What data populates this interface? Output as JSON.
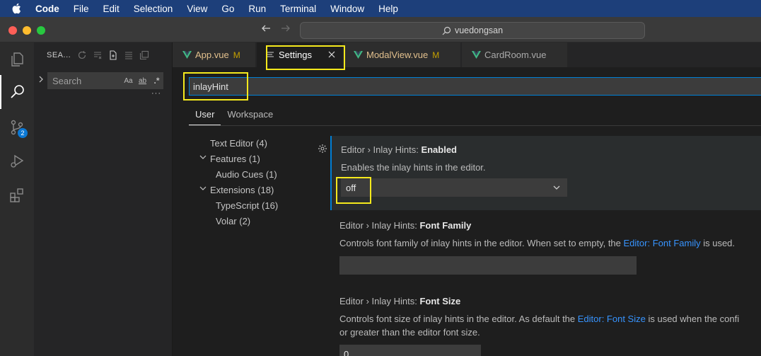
{
  "menubar": {
    "app_name": "Code",
    "items": [
      "File",
      "Edit",
      "Selection",
      "View",
      "Go",
      "Run",
      "Terminal",
      "Window",
      "Help"
    ]
  },
  "titlebar": {
    "command_center": "vuedongsan"
  },
  "activity": {
    "scm_badge": "2"
  },
  "sidebar": {
    "title": "SEA...",
    "search_placeholder": "Search",
    "opt_case": "Aa",
    "opt_word": "ab",
    "opt_regex": ".*",
    "more": "···"
  },
  "tabs": [
    {
      "label": "App.vue",
      "modified": "M"
    },
    {
      "label": "Settings"
    },
    {
      "label": "ModalView.vue",
      "modified": "M"
    },
    {
      "label": "CardRoom.vue"
    }
  ],
  "settings": {
    "search_value": "inlayHint",
    "scopes": [
      "User",
      "Workspace"
    ],
    "toc": [
      {
        "label": "Text Editor (4)"
      },
      {
        "label": "Features (1)"
      },
      {
        "label": "Audio Cues (1)"
      },
      {
        "label": "Extensions (18)"
      },
      {
        "label": "TypeScript (16)"
      },
      {
        "label": "Volar (2)"
      }
    ],
    "items": [
      {
        "category": "Editor › Inlay Hints: ",
        "name": "Enabled",
        "description": "Enables the inlay hints in the editor.",
        "value": "off"
      },
      {
        "category": "Editor › Inlay Hints: ",
        "name": "Font Family",
        "desc_before": "Controls font family of inlay hints in the editor. When set to empty, the ",
        "desc_link": "Editor: Font Family",
        "desc_after": " is used.",
        "value": ""
      },
      {
        "category": "Editor › Inlay Hints: ",
        "name": "Font Size",
        "desc_before": "Controls font size of inlay hints in the editor. As default the ",
        "desc_link": "Editor: Font Size",
        "desc_after": " is used when the confi",
        "desc_line2": "or greater than the editor font size.",
        "value": "0"
      }
    ]
  },
  "colors": {
    "accent": "#007fd4",
    "annotation": "#f5e91c",
    "vue_green": "#41b883"
  }
}
